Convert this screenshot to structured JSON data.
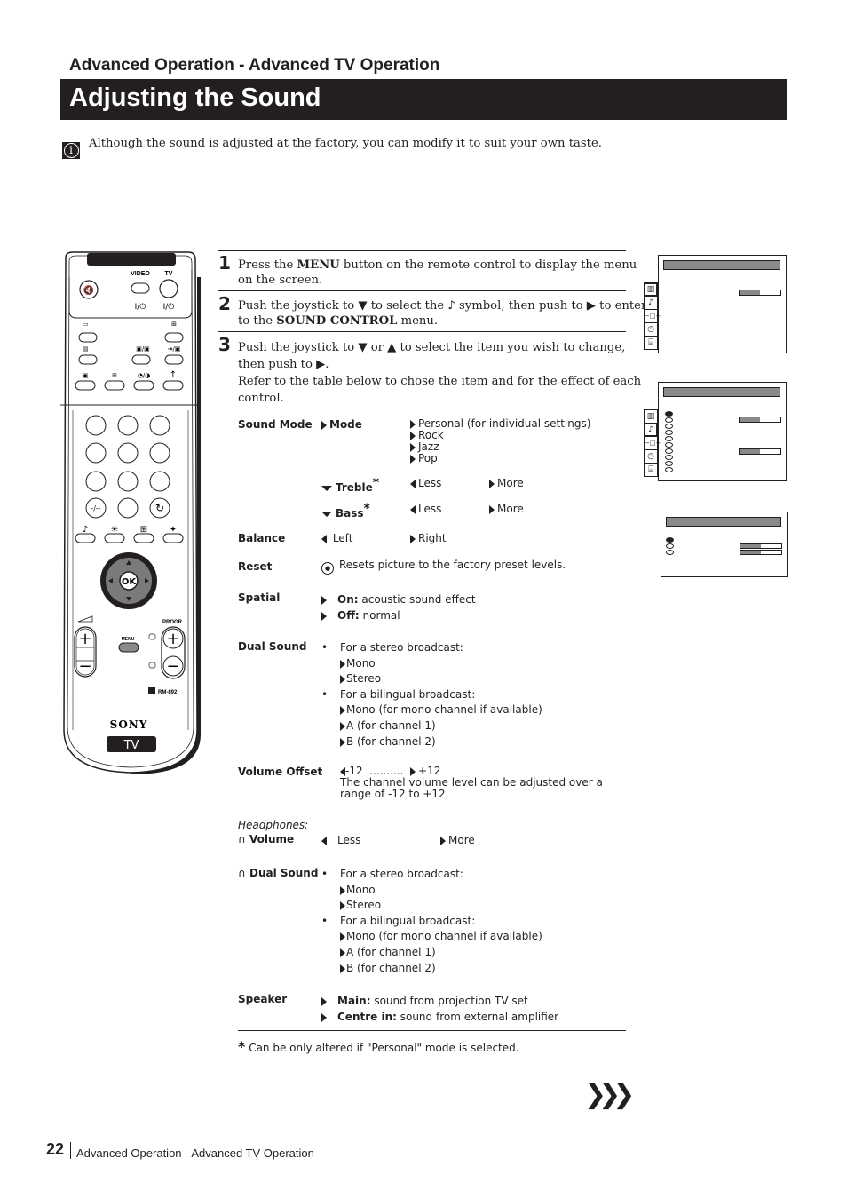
{
  "header": {
    "section_title": "Advanced Operation - Advanced TV Operation",
    "page_title": "Adjusting the Sound"
  },
  "intro": {
    "icon": "info-icon",
    "text": "Although the sound is adjusted at the factory, you can modify it to suit your own taste."
  },
  "steps": [
    {
      "number": "1",
      "pre": "Press the ",
      "bold": "MENU",
      "post": " button on the remote control to display the menu",
      "line2": "on the screen."
    },
    {
      "number": "2",
      "line1": "Push the joystick to ▼ to select the ♪ symbol, then push to ▶ to enter",
      "pre": "to the ",
      "bold": "SOUND CONTROL",
      "post": " menu."
    },
    {
      "number": "3",
      "line1": "Push the joystick to ▼ or ▲ to select the item you wish to change,",
      "line2": "then push to ▶.",
      "line3": "Refer to the table below to chose the item and for the effect of each",
      "line4": "control."
    }
  ],
  "table": {
    "sound_mode": {
      "label": "Sound Mode",
      "mode_label": "Mode",
      "mode_options": [
        "Personal (for individual settings)",
        "Rock",
        "Jazz",
        "Pop"
      ],
      "treble_label": "Treble",
      "bass_label": "Bass",
      "asterisk": "*",
      "less": "Less",
      "more": "More"
    },
    "balance": {
      "label": "Balance",
      "left": "Left",
      "right": "Right"
    },
    "reset": {
      "label": "Reset",
      "text": "Resets picture to the factory preset levels."
    },
    "spatial": {
      "label": "Spatial",
      "on_label": "On:",
      "on_text": " acoustic sound effect",
      "off_label": "Off:",
      "off_text": " normal"
    },
    "dual_sound": {
      "label": "Dual Sound",
      "bullet": "•",
      "stereo_heading": "For a stereo broadcast:",
      "stereo_options": [
        "Mono",
        "Stereo"
      ],
      "bilingual_heading": "For a bilingual broadcast:",
      "bilingual_options": [
        "Mono (for mono channel if available)",
        "A (for channel 1)",
        "B (for channel 2)"
      ]
    },
    "volume_offset": {
      "label": "Volume Offset",
      "min": "-12",
      "dots": "..........",
      "max": "+12",
      "description_1": "The channel volume level can be adjusted over a",
      "description_2": "range of -12 to +12."
    },
    "headphones": {
      "heading": "Headphones:",
      "headphone_icon": "∩",
      "volume_label": "Volume",
      "less": "Less",
      "more": "More",
      "dual_label": "Dual Sound",
      "stereo_heading": "For a stereo broadcast:",
      "stereo_options": [
        "Mono",
        "Stereo"
      ],
      "bilingual_heading": "For a bilingual broadcast:",
      "bilingual_options": [
        "Mono (for mono channel if available)",
        "A (for channel 1)",
        "B (for channel 2)"
      ]
    },
    "speaker": {
      "label": "Speaker",
      "main_label": "Main:",
      "main_text": " sound from projection TV set",
      "centre_label": "Centre in:",
      "centre_text": " sound from external amplifier"
    }
  },
  "footnote": {
    "asterisk": "*",
    "text": "Can be only altered if \"Personal\" mode is selected."
  },
  "osd_screens": {
    "menu_icons": [
      "picture-icon",
      "music-note-icon",
      "connection-icon",
      "clock-icon",
      "toolbox-icon"
    ],
    "tab_glyphs": [
      "▥",
      "♪",
      "−□−",
      "◷",
      "⌸"
    ],
    "screen1_level": 0.5,
    "screen2_levels": [
      0.5,
      0.5
    ],
    "screen3_levels": [
      0.5,
      0.5
    ]
  },
  "remote": {
    "video_label": "VIDEO",
    "tv_label": "TV",
    "power_symbol": "I/⏻",
    "menu_label": "MENU",
    "progr_label": "PROGR",
    "model": "RM-892",
    "brand": "SONY",
    "badge": "TV",
    "numpad_special": [
      "-/--",
      "",
      "↻"
    ],
    "bottom_row_icons": [
      "♪",
      "☀",
      "⊞",
      "✦"
    ],
    "ok_label": "OK",
    "plus": "+",
    "minus": "−"
  },
  "next_page_glyph": "❯❯❯",
  "footer": {
    "page_number": "22",
    "text": "Advanced Operation - Advanced TV Operation"
  }
}
